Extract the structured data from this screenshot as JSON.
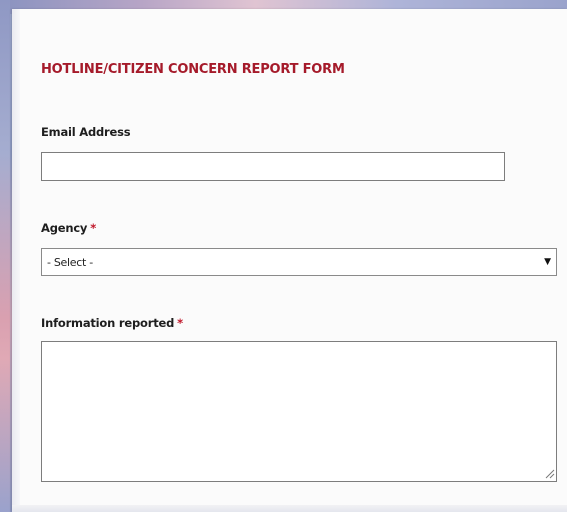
{
  "form": {
    "title": "HOTLINE/CITIZEN CONCERN REPORT FORM",
    "email": {
      "label": "Email Address",
      "value": ""
    },
    "agency": {
      "label": "Agency",
      "required_marker": "*",
      "selected": "- Select -"
    },
    "information": {
      "label": "Information reported",
      "required_marker": "*",
      "value": ""
    }
  },
  "colors": {
    "title": "#a51a2a",
    "required": "#c0172a",
    "border": "#7d7d7d"
  },
  "icons": {
    "select_arrow": "dropdown-arrow-icon",
    "resize": "resize-grip-icon"
  }
}
